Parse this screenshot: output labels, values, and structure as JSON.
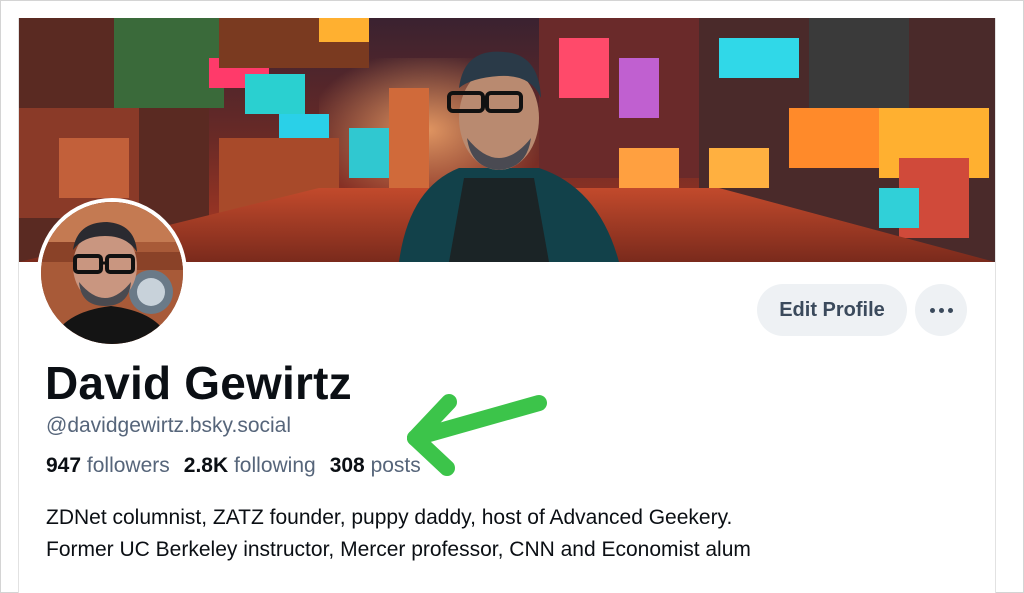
{
  "profile": {
    "display_name": "David Gewirtz",
    "handle": "@davidgewirtz.bsky.social",
    "stats": {
      "followers_count": "947",
      "followers_label": "followers",
      "following_count": "2.8K",
      "following_label": "following",
      "posts_count": "308",
      "posts_label": "posts"
    },
    "bio": {
      "line1": "ZDNet columnist, ZATZ founder, puppy daddy, host of Advanced Geekery.",
      "line2": "Former UC Berkeley instructor, Mercer professor, CNN and Economist alum"
    }
  },
  "actions": {
    "edit_profile_label": "Edit Profile",
    "more_icon": "ellipsis-icon"
  },
  "colors": {
    "text_primary": "#0b0f14",
    "text_secondary": "#56657a",
    "button_bg": "#eef1f4",
    "annotation_arrow": "#3cc44a"
  }
}
